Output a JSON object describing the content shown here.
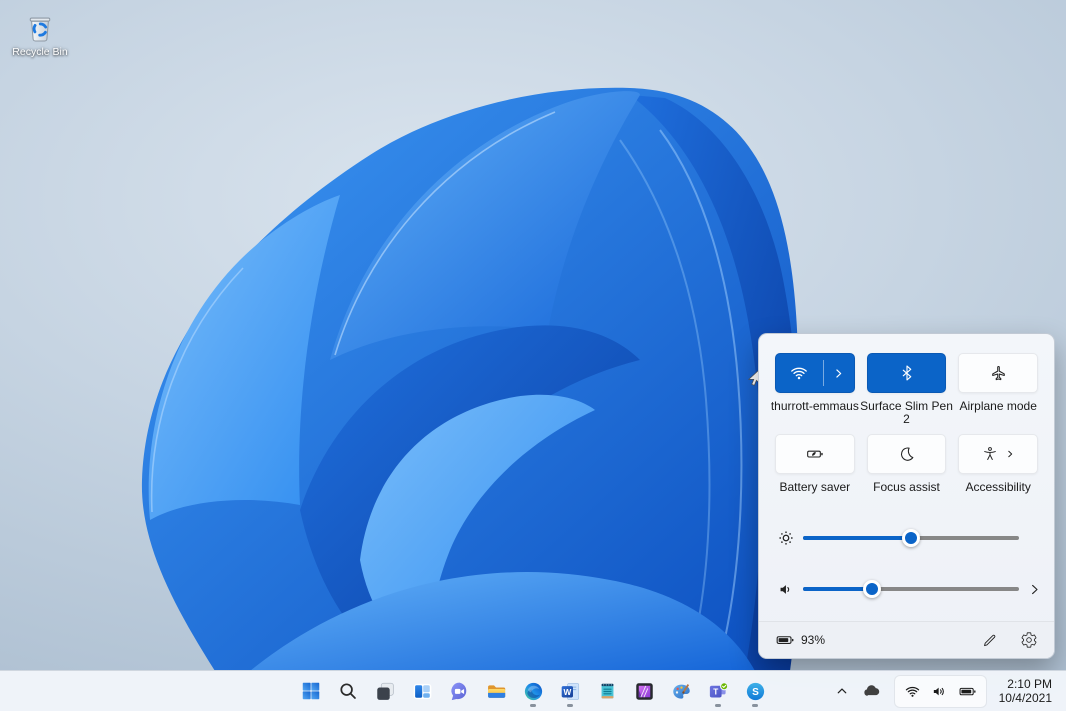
{
  "desktop": {
    "recycle_bin_label": "Recycle Bin",
    "mouse_cursor": "arrow-pointer"
  },
  "quick_settings": {
    "accent_color": "#0b64c8",
    "tiles": [
      {
        "name": "wifi",
        "icon": "wifi-icon",
        "label": "thurrott-emmaus",
        "state": "on",
        "expandable": true
      },
      {
        "name": "bluetooth",
        "icon": "bluetooth-icon",
        "label": "Surface Slim Pen 2",
        "state": "on",
        "expandable": false
      },
      {
        "name": "airplane-mode",
        "icon": "airplane-icon",
        "label": "Airplane mode",
        "state": "off",
        "expandable": false
      },
      {
        "name": "battery-saver",
        "icon": "battery-saver-icon",
        "label": "Battery saver",
        "state": "off",
        "expandable": false
      },
      {
        "name": "focus-assist",
        "icon": "moon-icon",
        "label": "Focus assist",
        "state": "off",
        "expandable": false
      },
      {
        "name": "accessibility",
        "icon": "accessibility-icon",
        "label": "Accessibility",
        "state": "off",
        "expandable": true
      }
    ],
    "sliders": [
      {
        "name": "brightness",
        "icon": "brightness-icon",
        "value_percent": 50
      },
      {
        "name": "volume",
        "icon": "volume-icon",
        "value_percent": 32,
        "expandable": true
      }
    ],
    "footer": {
      "battery_icon": "battery-icon",
      "battery_percent": "93%",
      "actions": [
        "edit-pencil-icon",
        "settings-gear-icon"
      ]
    }
  },
  "taskbar": {
    "apps": [
      {
        "name": "start",
        "running": false
      },
      {
        "name": "search",
        "running": false
      },
      {
        "name": "task-view",
        "running": false
      },
      {
        "name": "widgets",
        "running": false
      },
      {
        "name": "chat",
        "running": false
      },
      {
        "name": "file-explorer",
        "running": false
      },
      {
        "name": "edge",
        "running": true
      },
      {
        "name": "word",
        "running": true
      },
      {
        "name": "notepad",
        "running": false
      },
      {
        "name": "affinity-photo",
        "running": false
      },
      {
        "name": "paint",
        "running": false
      },
      {
        "name": "teams",
        "running": true
      },
      {
        "name": "skype",
        "running": true
      }
    ],
    "tray": {
      "icons": [
        "chevron-up-icon",
        "onedrive-cloud-icon",
        "wifi-icon",
        "speaker-icon",
        "battery-icon"
      ],
      "time": "2:10 PM",
      "date": "10/4/2021"
    }
  }
}
